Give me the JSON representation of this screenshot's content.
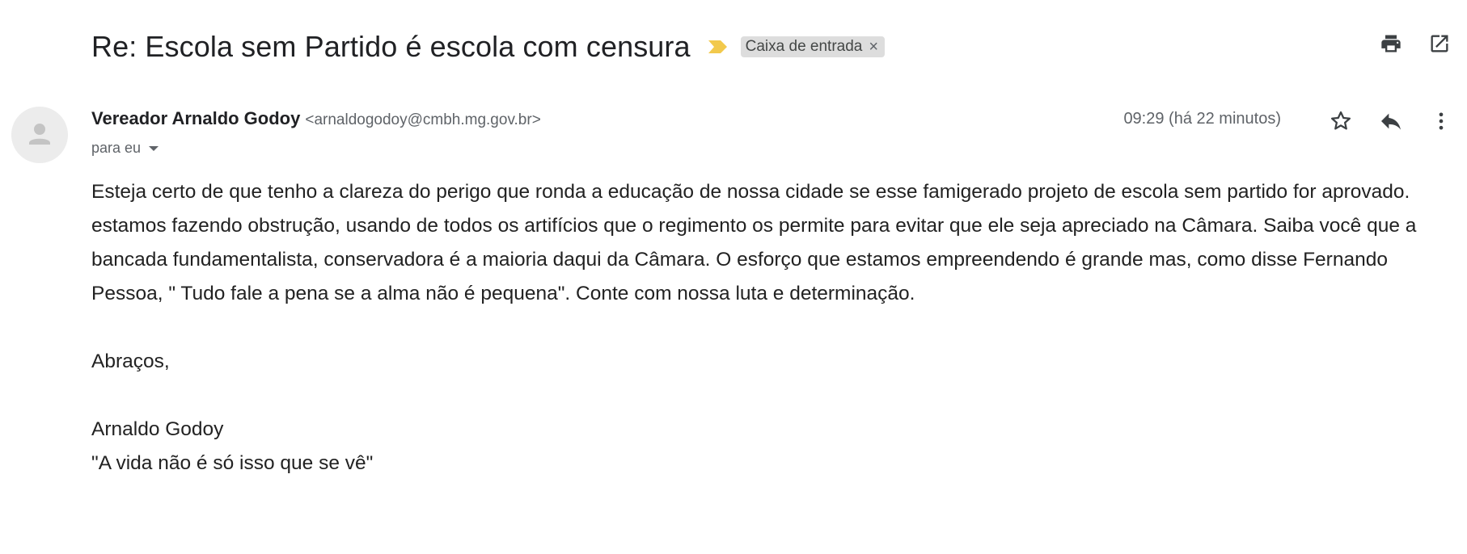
{
  "header": {
    "subject": "Re: Escola sem Partido é escola com censura",
    "label_chip": "Caixa de entrada",
    "label_close": "×",
    "icons": [
      "importance-marker-icon",
      "print-icon",
      "open-in-new-window-icon"
    ]
  },
  "message": {
    "sender_name": "Vereador Arnaldo Godoy",
    "sender_email": "<arnaldogodoy@cmbh.mg.gov.br>",
    "recipients": "para eu",
    "timestamp": "09:29 (há 22 minutos)",
    "action_icons": [
      "star-icon",
      "reply-icon",
      "more-vertical-icon"
    ],
    "body_paragraph": "Esteja certo de que tenho a clareza do perigo que ronda a educação de nossa cidade se esse famigerado projeto de escola sem partido for aprovado. estamos fazendo obstrução, usando de todos os artifícios que o regimento os permite para evitar que ele seja apreciado na Câmara. Saiba você que a bancada fundamentalista, conservadora é a maioria daqui da Câmara. O esforço que estamos empreendendo é grande mas, como disse Fernando Pessoa, \" Tudo fale a pena se a alma não é pequena\". Conte com nossa luta e determinação.",
    "closing": "Abraços,",
    "signature_name": "Arnaldo Godoy",
    "signature_quote": "\"A vida não é só isso que se vê\""
  },
  "colors": {
    "importance_marker": "#f2c94c",
    "chip_background": "#dddddd",
    "icon_dark": "#3c4043",
    "text_secondary": "#5f6368"
  }
}
